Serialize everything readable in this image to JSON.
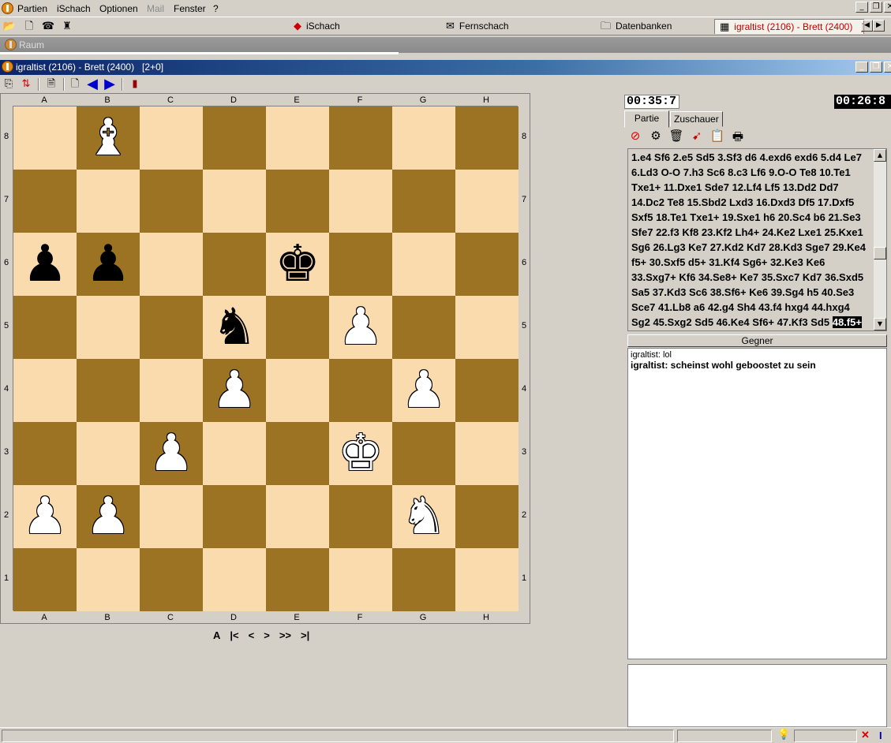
{
  "menubar": {
    "items": [
      "Partien",
      "iSchach",
      "Optionen",
      "Mail",
      "Fenster",
      "?"
    ],
    "disabled": [
      "Mail"
    ]
  },
  "tabs": [
    {
      "label": "iSchach",
      "icon": "ischach-icon"
    },
    {
      "label": "Fernschach",
      "icon": "fernschach-icon"
    },
    {
      "label": "Datenbanken",
      "icon": "database-icon"
    },
    {
      "label": "igraltist (2106) - Brett (2400)   [2+",
      "icon": "board-icon"
    }
  ],
  "raum": {
    "label": "Raum"
  },
  "window": {
    "title": "igraltist (2106) - Brett (2400)   [2+0]"
  },
  "board": {
    "files": [
      "A",
      "B",
      "C",
      "D",
      "E",
      "F",
      "G",
      "H"
    ],
    "ranks": [
      "8",
      "7",
      "6",
      "5",
      "4",
      "3",
      "2",
      "1"
    ],
    "squares": [
      [
        "",
        "wB",
        "",
        "",
        "",
        "",
        "",
        ""
      ],
      [
        "",
        "",
        "",
        "",
        "",
        "",
        "",
        ""
      ],
      [
        "bP",
        "bP",
        "",
        "",
        "bK",
        "",
        "",
        ""
      ],
      [
        "",
        "",
        "",
        "bN",
        "",
        "wP",
        "",
        ""
      ],
      [
        "",
        "",
        "",
        "wP",
        "",
        "",
        "wP",
        ""
      ],
      [
        "",
        "",
        "wP",
        "",
        "",
        "wK",
        "",
        ""
      ],
      [
        "wP",
        "wP",
        "",
        "",
        "",
        "",
        "wN",
        ""
      ],
      [
        "",
        "",
        "",
        "",
        "",
        "",
        "",
        ""
      ]
    ]
  },
  "navigation": [
    "A",
    "|<",
    "<",
    ">",
    ">>",
    ">|"
  ],
  "clocks": {
    "white": "00:35:7",
    "black": "00:26:8"
  },
  "panel_tabs": [
    "Partie",
    "Zuschauer"
  ],
  "moves": {
    "text": "1.e4 Sf6 2.e5 Sd5 3.Sf3 d6 4.exd6 exd6 5.d4 Le7 6.Ld3 O-O 7.h3 Sc6 8.c3 Lf6 9.O-O Te8 10.Te1 Txe1+ 11.Dxe1 Sde7 12.Lf4 Lf5 13.Dd2 Dd7 14.Dc2 Te8 15.Sbd2 Lxd3 16.Dxd3 Df5 17.Dxf5 Sxf5 18.Te1 Txe1+ 19.Sxe1 h6 20.Sc4 b6 21.Se3 Sfe7 22.f3 Kf8 23.Kf2 Lh4+ 24.Ke2 Lxe1 25.Kxe1 Sg6 26.Lg3 Ke7 27.Kd2 Kd7 28.Kd3 Sge7 29.Ke4 f5+ 30.Sxf5 d5+ 31.Kf4 Sg6+ 32.Ke3 Ke6 33.Sxg7+ Kf6 34.Se8+ Ke7 35.Sxc7 Kd7 36.Sxd5 Sa5 37.Kd3 Sc6 38.Sf6+ Ke6 39.Sg4 h5 40.Se3 Sce7 41.Lb8 a6 42.g4 Sh4 43.f4 hxg4 44.hxg4 Sg2 45.Sxg2 Sd5 46.Ke4 Sf6+ 47.Kf3 Sd5",
    "current": "48.f5+"
  },
  "gegner_label": "Gegner",
  "chat": [
    {
      "text": "igraltist: lol",
      "bold": false
    },
    {
      "text": "igraltist: scheinst wohl geboostet zu sein",
      "bold": true
    }
  ],
  "colors": {
    "light_square": "#f9dbae",
    "dark_square": "#9c7223",
    "title_bar": "#0a246a",
    "active_tab_text": "#c00000"
  }
}
